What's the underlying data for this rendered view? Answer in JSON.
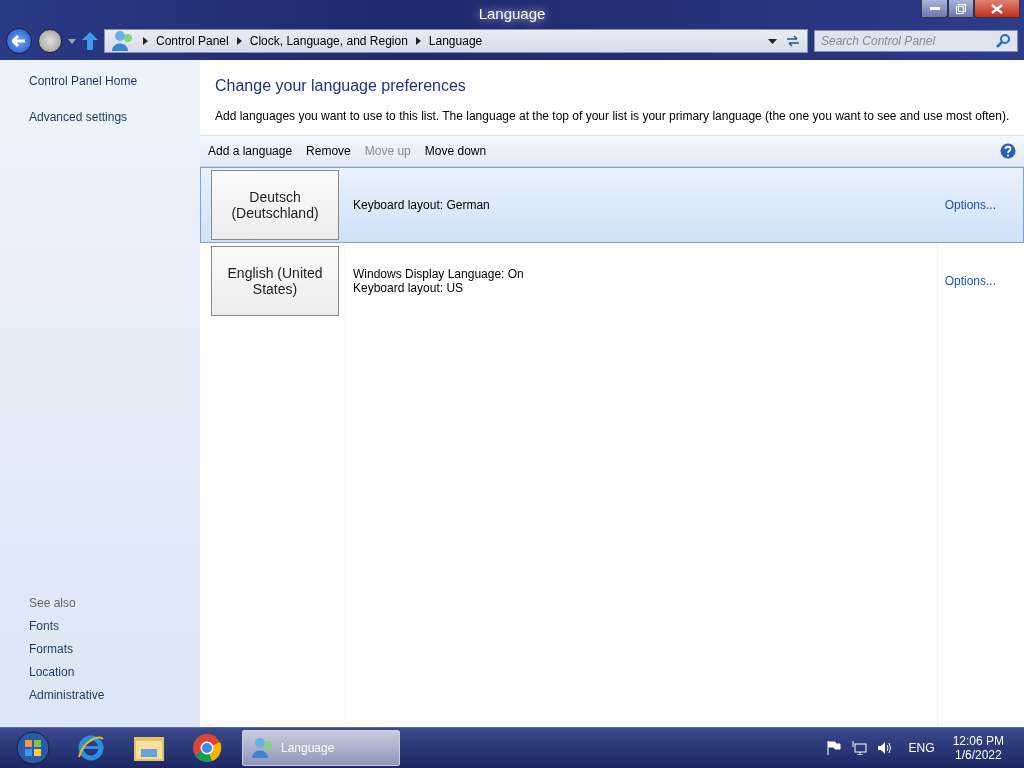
{
  "window": {
    "title": "Language"
  },
  "address": {
    "crumbs": [
      "Control Panel",
      "Clock, Language, and Region",
      "Language"
    ]
  },
  "search": {
    "placeholder": "Search Control Panel"
  },
  "sidebar": {
    "links": [
      "Control Panel Home",
      "Advanced settings"
    ],
    "see_also_title": "See also",
    "see_also": [
      "Fonts",
      "Formats",
      "Location",
      "Administrative"
    ]
  },
  "heading": "Change your language preferences",
  "description": "Add languages you want to use to this list. The language at the top of your list is your primary language (the one you want to see and use most often).",
  "toolbar": [
    {
      "label": "Add a language",
      "disabled": false
    },
    {
      "label": "Remove",
      "disabled": false
    },
    {
      "label": "Move up",
      "disabled": true
    },
    {
      "label": "Move down",
      "disabled": false
    }
  ],
  "languages": [
    {
      "name": "Deutsch (Deutschland)",
      "details": [
        "Keyboard layout: German"
      ],
      "options": "Options...",
      "selected": true
    },
    {
      "name": "English (United States)",
      "details": [
        "Windows Display Language: On",
        "Keyboard layout: US"
      ],
      "options": "Options...",
      "selected": false
    }
  ],
  "taskbar": {
    "apps": [
      {
        "kind": "browser-e"
      },
      {
        "kind": "folder"
      },
      {
        "kind": "chrome"
      }
    ],
    "window_button": {
      "label": "Language",
      "active": true
    },
    "language": "ENG",
    "time": "12:06 PM",
    "date": "1/6/2022"
  }
}
